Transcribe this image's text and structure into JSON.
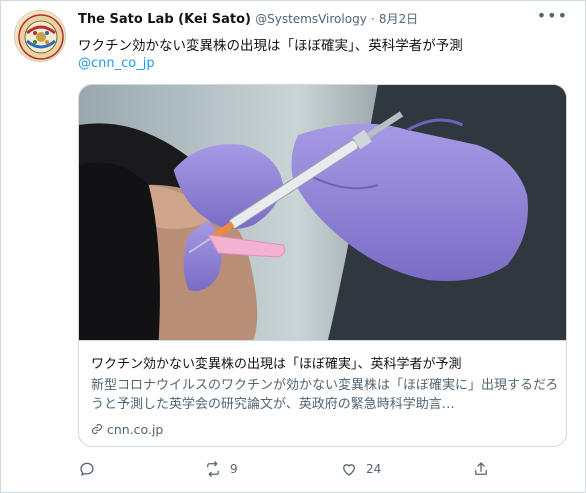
{
  "tweet": {
    "display_name": "The Sato Lab (Kei Sato)",
    "handle": "@SystemsVirology",
    "separator": "·",
    "date": "8月2日",
    "more_label": "•••",
    "text": "ワクチン効かない変異株の出現は「ほぼ確実」、英科学者が予測",
    "mention_link": "@cnn_co_jp"
  },
  "avatar": {
    "text_top": "SATO LAB",
    "text_middle": "SYSTEMS VIROLOGY",
    "text_bottom": "G2P-JAPAN"
  },
  "card": {
    "title": "ワクチン効かない変異株の出現は「ほぼ確実」、英科学者が予測",
    "description": "新型コロナウイルスのワクチンが効かない変異株は「ほぼ確実に」出現するだろうと予測した英学会の研究論文が、英政府の緊急時科学助言…",
    "domain": "cnn.co.jp",
    "image_icon": "vaccine-injection-photo"
  },
  "actions": {
    "reply_count": "",
    "retweet_count": "9",
    "like_count": "24",
    "icons": [
      "reply-icon",
      "retweet-icon",
      "like-icon",
      "share-icon"
    ]
  },
  "colors": {
    "link": "#1d9bf0",
    "secondary_text": "#536471",
    "glove": "#8f82d6",
    "border": "#cfd9de"
  }
}
